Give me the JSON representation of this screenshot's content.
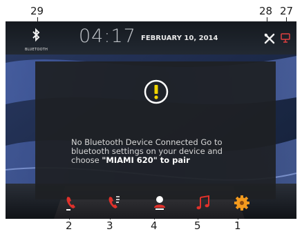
{
  "callouts": {
    "c29": "29",
    "c28": "28",
    "c27": "27",
    "c2": "2",
    "c3": "3",
    "c4": "4",
    "c5": "5",
    "c1": "1"
  },
  "status_bar": {
    "bluetooth_caption": "BLUETOOTH",
    "time": "04:17",
    "date": "FEBRUARY 10, 2014"
  },
  "dialog": {
    "message_line1": "No Bluetooth Device Connected Go to",
    "message_line2": "bluetooth settings on your device and",
    "message_line3_prefix": "choose ",
    "message_line3_device": "\"MIAMI 620\" to pair"
  },
  "colors": {
    "accent_red": "#e0312b",
    "accent_orange": "#f39a1e",
    "alert_yellow": "#f0d400"
  },
  "icons": {
    "status": [
      "bluetooth-icon",
      "tools-icon",
      "display-icon"
    ],
    "dock": [
      "phone-icon",
      "call-log-icon",
      "contacts-icon",
      "music-icon",
      "settings-gear-icon"
    ]
  }
}
